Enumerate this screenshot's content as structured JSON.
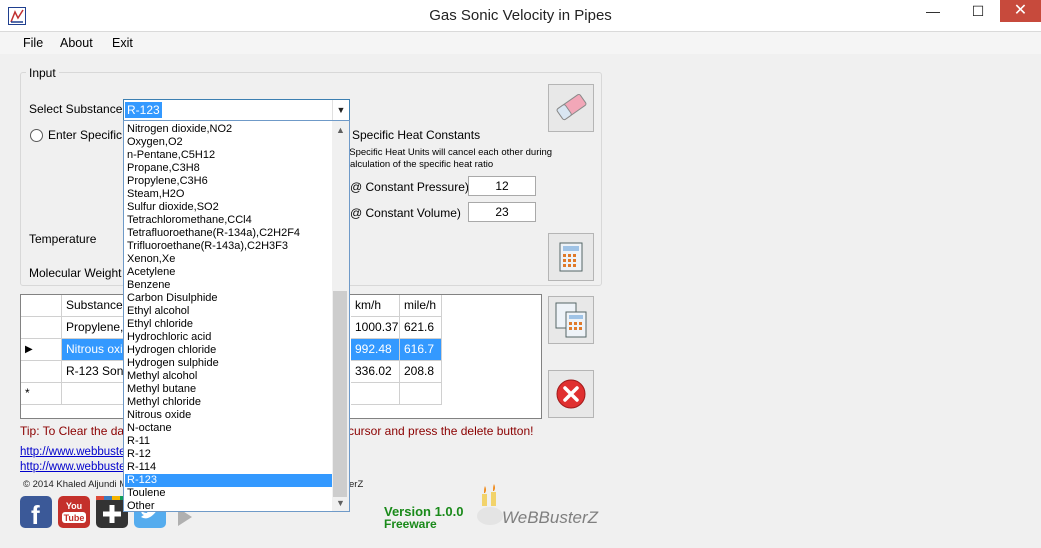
{
  "window": {
    "title": "Gas Sonic Velocity in Pipes",
    "controls": {
      "minimize": "—",
      "maximize": "☐",
      "close": "✕"
    }
  },
  "menu": [
    "File",
    "About",
    "Exit"
  ],
  "input_panel": {
    "legend": "Input",
    "select_substance_label": "Select Substance",
    "selected_substance": "R-123",
    "enter_specific_label": "Enter Specific H",
    "specific_heat_constants_label": "Specific Heat Constants",
    "note_line1": ": Specific Heat Units will cancel each other during",
    "note_line2": "alculation of the specific heat ratio",
    "cp_label": "@ Constant Pressure)",
    "cp_value": "12",
    "cv_label": "@ Constant Volume)",
    "cv_value": "23",
    "temperature_label": "Temperature",
    "molecular_weight_label": "Molecular Weight"
  },
  "dropdown_items": [
    "Nitrogen dioxide,NO2",
    "Oxygen,O2",
    "n-Pentane,C5H12",
    "Propane,C3H8",
    "Propylene,C3H6",
    "Steam,H2O",
    "Sulfur dioxide,SO2",
    "Tetrachloromethane,CCl4",
    "Tetrafluoroethane(R-134a),C2H2F4",
    "Trifluoroethane(R-143a),C2H3F3",
    "Xenon,Xe",
    "Acetylene",
    "Benzene",
    "Carbon Disulphide",
    "Ethyl alcohol",
    "Ethyl chloride",
    "Hydrochloric acid",
    "Hydrogen chloride",
    "Hydrogen sulphide",
    "Methyl alcohol",
    "Methyl butane",
    "Methyl chloride",
    "Nitrous oxide",
    "N-octane",
    "R-11",
    "R-12",
    "R-114",
    "R-123",
    "Toulene",
    "Other"
  ],
  "dropdown_selected": "R-123",
  "grid": {
    "headers": [
      "Substance",
      "km/h",
      "mile/h"
    ],
    "rows": [
      {
        "substance": "Propylene,C",
        "kmh": "1000.37",
        "mileh": "621.6",
        "selected": false
      },
      {
        "substance": "Nitrous oxide",
        "kmh": "992.48",
        "mileh": "616.7",
        "selected": true
      },
      {
        "substance": "R-123 Sonic",
        "kmh": "336.02",
        "mileh": "208.8",
        "selected": false
      }
    ],
    "new_row_marker": "*",
    "current_row_marker": "▶"
  },
  "tip": "Tip: To Clear the data",
  "tip_tail": "cursor and press the delete button!",
  "links": [
    "http://www.webbuster",
    "http://www.webbuster"
  ],
  "copyright": "© 2014 Khaled Aljundi M",
  "copyright_tail": "erZ",
  "version": "Version 1.0.0",
  "freeware": "Freeware",
  "brand": "WeBBusterZ",
  "social_icons": [
    "facebook-icon",
    "youtube-icon",
    "googleplus-icon",
    "twitter-icon",
    "play-store-icon"
  ],
  "colors": {
    "selection": "#3399ff",
    "tip": "#8b0000",
    "link": "#0000cc",
    "version": "#1a8a1a",
    "close_button": "#c74a3c",
    "delete_button": "#e03030"
  }
}
